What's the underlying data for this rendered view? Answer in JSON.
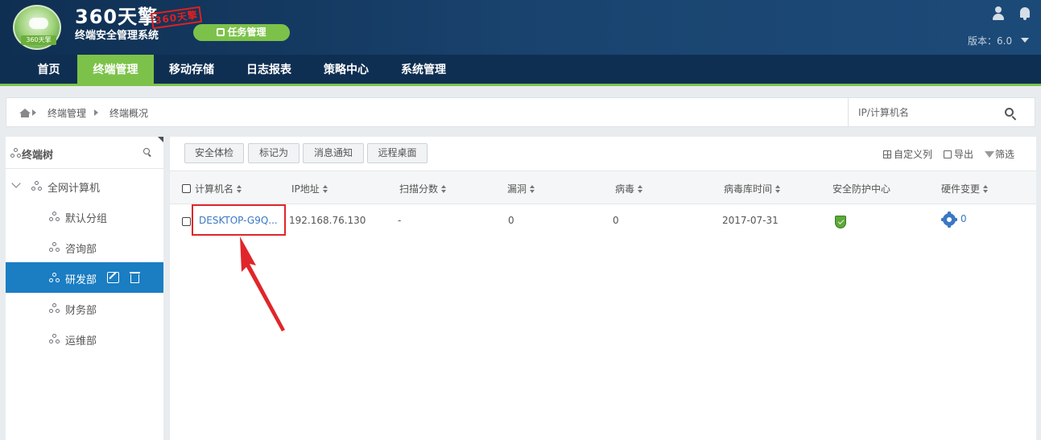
{
  "header": {
    "brand_title": "360天擎",
    "brand_stamp": "360天擎",
    "brand_subtitle": "终端安全管理系统",
    "badge_text": "360天擎",
    "task_button": "任务管理",
    "version_label": "版本：6.0"
  },
  "nav": {
    "items": [
      {
        "label": "首页",
        "active": false
      },
      {
        "label": "终端管理",
        "active": true
      },
      {
        "label": "移动存储",
        "active": false
      },
      {
        "label": "日志报表",
        "active": false
      },
      {
        "label": "策略中心",
        "active": false
      },
      {
        "label": "系统管理",
        "active": false
      }
    ]
  },
  "breadcrumb": {
    "items": [
      "终端管理",
      "终端概况"
    ]
  },
  "search": {
    "placeholder": "IP/计算机名"
  },
  "tree": {
    "title": "终端树",
    "root": "全网计算机",
    "groups": [
      {
        "label": "默认分组",
        "active": false
      },
      {
        "label": "咨询部",
        "active": false
      },
      {
        "label": "研发部",
        "active": true
      },
      {
        "label": "财务部",
        "active": false
      },
      {
        "label": "运维部",
        "active": false
      }
    ]
  },
  "toolbar": {
    "buttons": [
      "安全体检",
      "标记为",
      "消息通知",
      "远程桌面"
    ],
    "custom_columns": "自定义列",
    "export": "导出",
    "filter": "筛选"
  },
  "table": {
    "columns": [
      "计算机名",
      "IP地址",
      "扫描分数",
      "漏洞",
      "病毒",
      "病毒库时间",
      "安全防护中心",
      "硬件变更"
    ],
    "rows": [
      {
        "computer_name": "DESKTOP-G9Q...",
        "ip": "192.168.76.130",
        "scan_score": "-",
        "vulnerabilities": "0",
        "viruses": "0",
        "virus_db_time": "2017-07-31",
        "security_center": "shield-icon",
        "hardware_changes": "0"
      }
    ]
  },
  "colors": {
    "header_bg": "#0f2f52",
    "accent_green": "#7cc24a",
    "active_blue": "#1b7dc2",
    "link_blue": "#3a78c4",
    "annotation_red": "#e0262a"
  }
}
